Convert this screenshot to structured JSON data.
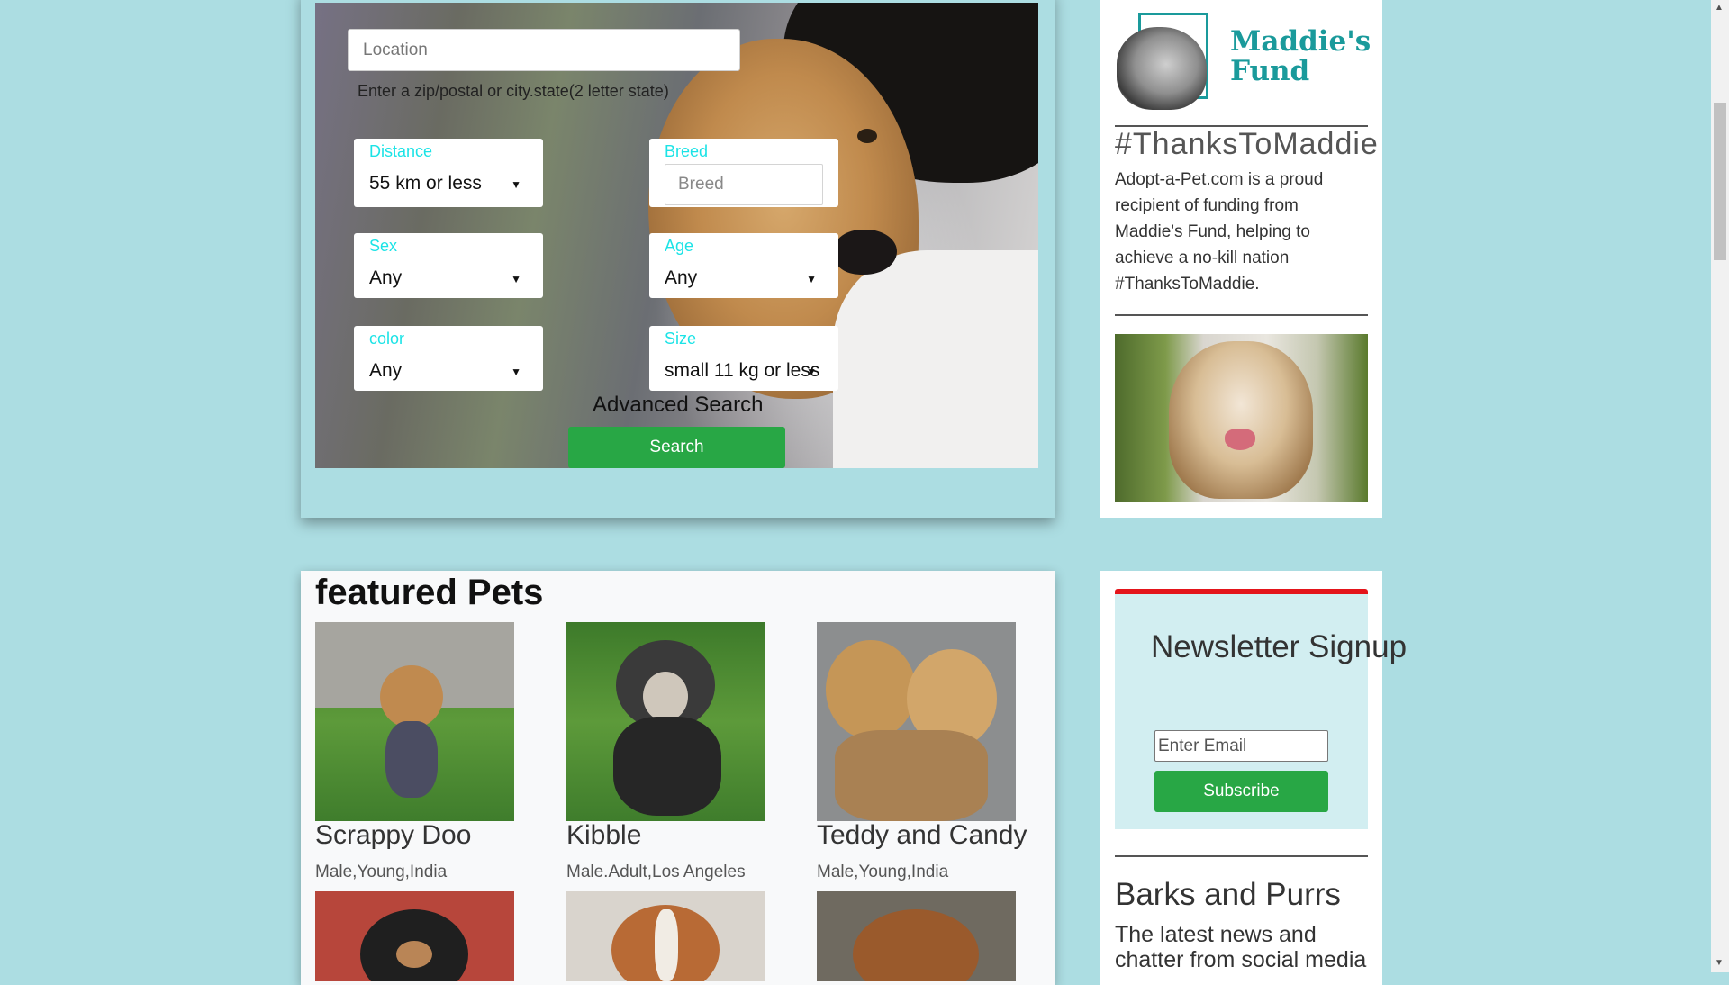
{
  "search": {
    "location_placeholder": "Location",
    "location_hint": "Enter a zip/postal or city.state(2 letter state)",
    "fields": {
      "distance": {
        "label": "Distance",
        "value": "55 km or less"
      },
      "breed": {
        "label": "Breed",
        "placeholder": "Breed"
      },
      "sex": {
        "label": "Sex",
        "value": "Any"
      },
      "age": {
        "label": "Age",
        "value": "Any"
      },
      "color": {
        "label": "color",
        "value": "Any"
      },
      "size": {
        "label": "Size",
        "value": "small 11 kg or less"
      }
    },
    "advanced_label": "Advanced Search",
    "search_button": "Search",
    "label_color": "#1ce3e6",
    "button_color": "#28a745"
  },
  "sidebar": {
    "logo_text_line1": "Maddie's",
    "logo_text_line2": "Fund",
    "hashtag_title": "#ThanksToMaddie",
    "body": "Adopt-a-Pet.com is a proud recipient of funding from Maddie's Fund, helping to achieve a no-kill nation #ThanksToMaddie.",
    "accent_color": "#1a9a9b"
  },
  "featured": {
    "title": "featured Pets",
    "pets": [
      {
        "name": "Scrappy Doo",
        "meta": "Male,Young,India"
      },
      {
        "name": "Kibble",
        "meta": "Male.Adult,Los Angeles"
      },
      {
        "name": "Teddy and Candy",
        "meta": "Male,Young,India"
      }
    ]
  },
  "newsletter": {
    "title": "Newsletter Signup",
    "email_placeholder": "Enter Email",
    "subscribe_button": "Subscribe",
    "top_border_color": "#e4151b"
  },
  "barks": {
    "title": "Barks and Purrs",
    "body": "The latest news and chatter from social media"
  },
  "colors": {
    "page_background": "#acdde2"
  }
}
